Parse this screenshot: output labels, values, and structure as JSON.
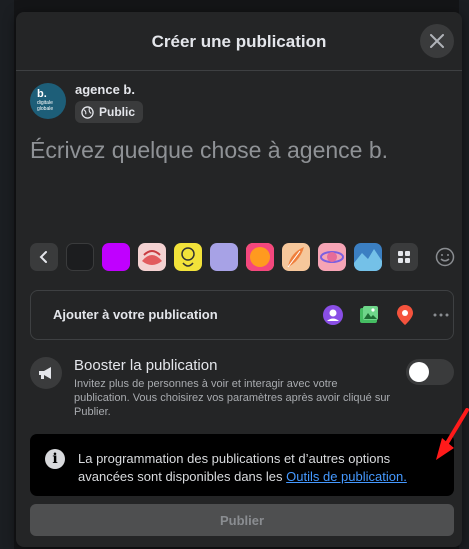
{
  "dialog": {
    "title": "Créer une publication",
    "close_icon": "close-icon"
  },
  "author": {
    "avatar_line1": "b.",
    "avatar_line2": "digitale globale",
    "name": "agence b.",
    "privacy_label": "Public",
    "privacy_icon": "globe-icon"
  },
  "composer": {
    "placeholder": "Écrivez quelque chose à agence b."
  },
  "backgrounds": {
    "prev_icon": "chevron-left-icon",
    "swatches": [
      {
        "name": "black",
        "color": "#1c1d1f"
      },
      {
        "name": "purple",
        "color": "#c000ff"
      },
      {
        "name": "red-pattern",
        "color": "#e98486"
      },
      {
        "name": "yellow-pattern",
        "color": "#f2e23a"
      },
      {
        "name": "lavender",
        "color": "#a7a2e6"
      },
      {
        "name": "orange-pink",
        "color": "#f4477d"
      },
      {
        "name": "orange-pattern",
        "color": "#f6c79b"
      },
      {
        "name": "pink-pattern",
        "color": "#f6a4b5"
      },
      {
        "name": "blue-pattern",
        "color": "#3b7fc2"
      }
    ],
    "grid_icon": "grid-icon",
    "emoji_icon": "emoji-icon"
  },
  "add_to_post": {
    "label": "Ajouter à votre publication",
    "icons": [
      "tag-people-icon",
      "photo-icon",
      "location-icon",
      "more-icon"
    ]
  },
  "boost": {
    "title": "Booster la publication",
    "description": "Invitez plus de personnes à voir et interagir avec votre publication. Vous choisirez vos paramètres après avoir cliqué sur Publier.",
    "toggle_on": false
  },
  "info": {
    "text": "La programmation des publications et d’autres options avancées sont disponibles dans les ",
    "link": "Outils de publication."
  },
  "publish": {
    "label": "Publier"
  },
  "colors": {
    "modal_bg": "#242526",
    "link": "#4599ff",
    "annotation_arrow": "#ff1a1a"
  }
}
